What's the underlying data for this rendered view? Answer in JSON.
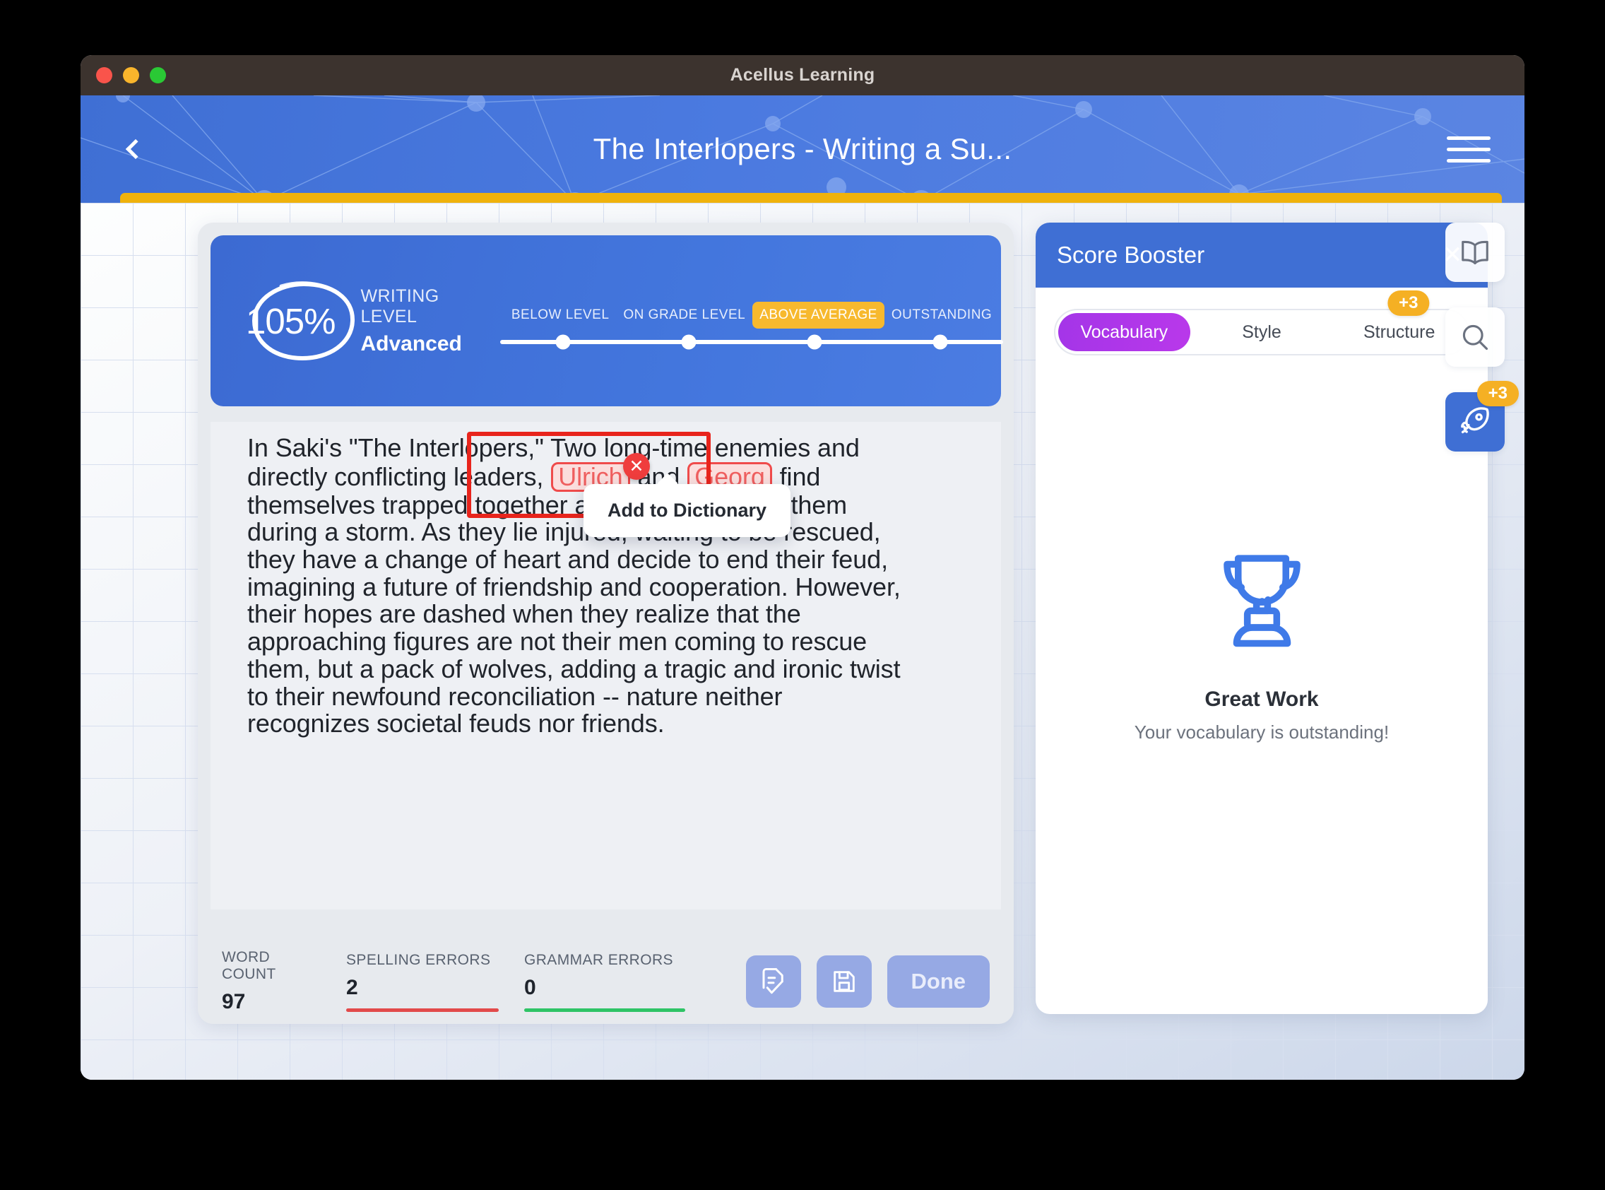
{
  "window": {
    "title": "Acellus Learning",
    "traffic_lights": [
      "close-red",
      "minimize-amber",
      "maximize-green"
    ]
  },
  "header": {
    "title": "The Interlopers - Writing a Su...",
    "back_icon": "chevron-left-icon",
    "menu_icon": "hamburger-menu-icon",
    "progress_color": "#efb20c"
  },
  "writing_level": {
    "score": "105%",
    "caption": "WRITING LEVEL",
    "value": "Advanced",
    "scale": [
      {
        "label": "BELOW LEVEL",
        "active": false
      },
      {
        "label": "ON GRADE LEVEL",
        "active": false
      },
      {
        "label": "ABOVE AVERAGE",
        "active": true
      },
      {
        "label": "OUTSTANDING",
        "active": false
      }
    ],
    "active_color": "#f7b92e"
  },
  "essay": {
    "line1_a": "In Saki's \"The Interlopers,\" Two long-time enemies and",
    "line2_a": "directly conflicting leaders, ",
    "error1": "Ulrich",
    "line2_b": " and ",
    "error2": "Georg",
    "line2_c": " find",
    "line3": "themselves trapped together after a tree falls on them",
    "line4": "during a storm. As they lie injured, waiting to be rescued,",
    "line5": "they have a change of heart and decide to end their feud,",
    "line6": "imagining a future of friendship and cooperation. However,",
    "line7": "their hopes are dashed when they realize that the",
    "line8": "approaching figures are not their men coming to rescue",
    "line9": "them, but a pack of wolves, adding a tragic and ironic twist",
    "line10": "to their newfound reconciliation -- nature neither",
    "line11": "recognizes societal feuds nor friends."
  },
  "annotation": {
    "close_icon": "close-circle-icon",
    "popup_label": "Add to Dictionary",
    "box_color": "#e8241c"
  },
  "stats": [
    {
      "caption": "WORD COUNT",
      "value": "97",
      "rule": "none"
    },
    {
      "caption": "SPELLING ERRORS",
      "value": "2",
      "rule": "#e24a4a"
    },
    {
      "caption": "GRAMMAR ERRORS",
      "value": "0",
      "rule": "#2fc466"
    }
  ],
  "footer_buttons": {
    "spellcheck_icon": "document-check-icon",
    "save_icon": "floppy-save-icon",
    "done_label": "Done"
  },
  "score_booster": {
    "title": "Score Booster",
    "close_icon": "close-icon",
    "tabs": [
      {
        "label": "Vocabulary",
        "active": true,
        "badge": null
      },
      {
        "label": "Style",
        "active": false,
        "badge": null
      },
      {
        "label": "Structure",
        "active": false,
        "badge": "+3"
      }
    ],
    "trophy_icon": "trophy-icon",
    "heading": "Great Work",
    "subtext": "Your vocabulary is outstanding!",
    "accent_color": "#a435e8"
  },
  "rail": [
    {
      "icon": "book-icon",
      "active": false,
      "badge": null
    },
    {
      "icon": "search-icon",
      "active": false,
      "badge": null
    },
    {
      "icon": "rocket-icon",
      "active": true,
      "badge": "+3"
    }
  ]
}
